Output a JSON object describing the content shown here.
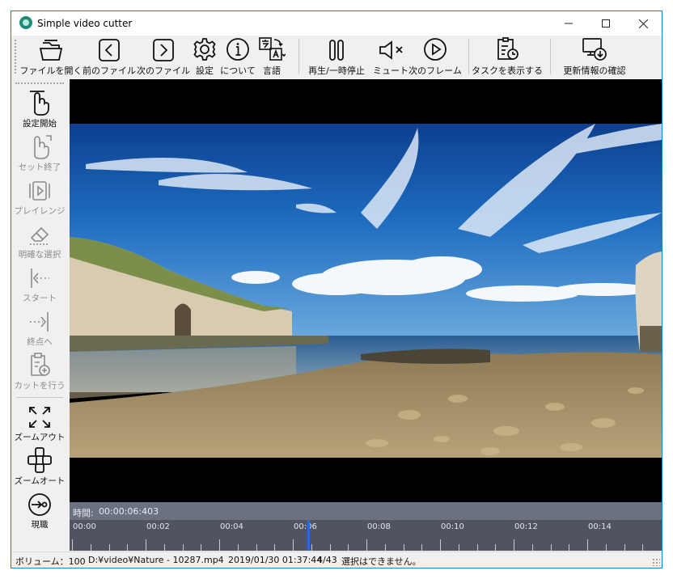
{
  "window": {
    "title": "Simple video cutter"
  },
  "toolbar": {
    "open_file": "ファイルを開く",
    "prev_file": "前のファイル",
    "next_file": "次のファイル",
    "settings": "設定",
    "about": "について",
    "language": "言語",
    "play_pause": "再生/一時停止",
    "mute": "ミュート",
    "next_frame": "次のフレーム",
    "show_tasks": "タスクを表示する",
    "check_updates": "更新情報の確認"
  },
  "sidebar": {
    "set_start": "設定開始",
    "set_end": "セット終了",
    "play_range": "プレイレンジ",
    "clear_selection": "明確な選択",
    "to_start": "スタート",
    "to_end": "終点へ",
    "do_cut": "カットを行う",
    "zoom_out": "ズームアウト",
    "zoom_auto": "ズームオート",
    "current": "現職"
  },
  "timeline": {
    "time_label": "時間:",
    "time_value": "00:00:06:403",
    "ticks": [
      "00:00",
      "00:02",
      "00:04",
      "00:06",
      "00:08",
      "00:10",
      "00:12",
      "00:14"
    ],
    "position_seconds": 6.403
  },
  "status": {
    "volume": "ボリューム：100",
    "path": "D:¥video¥Nature - 10287.mp4",
    "datetime": "2019/01/30 01:37:44",
    "count": "4/43",
    "message": "選択はできません。"
  },
  "colors": {
    "accent": "#1883d7",
    "timeline_bg": "#4f5460",
    "timebar_bg": "#6b7180",
    "playhead": "#1f6fd0"
  }
}
